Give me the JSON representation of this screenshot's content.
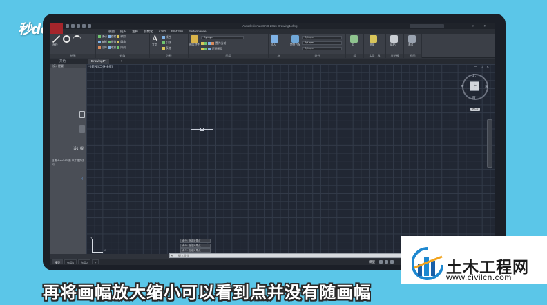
{
  "branding": {
    "logo_text": "秒dong视频"
  },
  "cad": {
    "app_title": "Autodesk AutoCAD 2016   Drawing1.dwg",
    "window_controls": "—  □  ✕",
    "menu_items": [
      "视图",
      "插入",
      "注释",
      "参数化",
      "A360",
      "BIM 360",
      "Performance"
    ],
    "ribbon_groups": [
      {
        "label": "绘图",
        "big": "直线"
      },
      {
        "label": "修改",
        "big": ""
      },
      {
        "label": "注释",
        "big": "文字"
      },
      {
        "label": "图层",
        "big": "图层特性"
      },
      {
        "label": "块",
        "big": "插入"
      },
      {
        "label": "特性",
        "big": "特性匹配"
      },
      {
        "label": "组",
        "big": "组"
      },
      {
        "label": "实用工具",
        "big": "测量"
      },
      {
        "label": "剪贴板",
        "big": "粘贴"
      },
      {
        "label": "视图",
        "big": "基点"
      }
    ],
    "layer_combo": "ByLayer",
    "prop_combos": [
      "ByLayer",
      "ByLayer",
      "ByLayer"
    ],
    "file_tabs": [
      "开始",
      "Drawing1*"
    ],
    "palette": {
      "header": "设计提要",
      "title": "设计提",
      "desc": "日期 AutoCAD 是 事并提供访问",
      "link": "◁"
    },
    "view_label": "[-][俯视][二维线框]",
    "canvas_controls": "—  □  ✕",
    "viewcube": {
      "face": "上",
      "north": "北",
      "south": "南",
      "east": "东",
      "west": "西",
      "wcs": "WCS"
    },
    "ucs": {
      "x": "X",
      "y": "Y"
    },
    "command_history": [
      "命令: 指定对角点",
      "命令: 指定对角点",
      "命令: 指定对角点"
    ],
    "command_placeholder": "键入命令",
    "layout_tabs": [
      "模型",
      "布局1",
      "布局2",
      "+"
    ],
    "status_model": "模型"
  },
  "watermark": {
    "name": "土木工程网",
    "url": "www.civilcn.com"
  },
  "subtitle": "再将画幅放大缩小可以看到点并没有随画幅"
}
